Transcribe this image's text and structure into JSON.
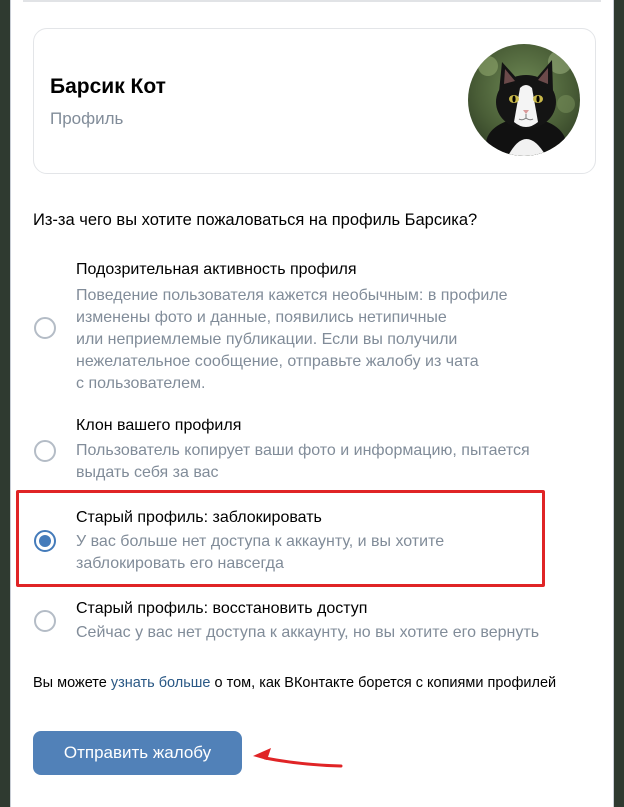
{
  "profile": {
    "name": "Барсик Кот",
    "subtitle": "Профиль",
    "avatar_icon": "cat-photo-avatar"
  },
  "question": "Из-за чего вы хотите пожаловаться на профиль Барсика?",
  "options": [
    {
      "title": "Подозрительная активность профиля",
      "description": "Поведение пользователя кажется необычным: в профиле\nизменены фото и данные, появились нетипичные\nили неприемлемые публикации. Если вы получили\nнежелательное сообщение, отправьте жалобу из чата\nс пользователем.",
      "selected": false
    },
    {
      "title": "Клон вашего профиля",
      "description": "Пользователь копирует ваши фото и информацию, пытается\nвыдать себя за вас",
      "selected": false
    },
    {
      "title": "Старый профиль: заблокировать",
      "description": "У вас больше нет доступа к аккаунту, и вы хотите\nзаблокировать его навсегда",
      "selected": true
    },
    {
      "title": "Старый профиль: восстановить доступ",
      "description": "Сейчас у вас нет доступа к аккаунту, но вы хотите его вернуть",
      "selected": false
    }
  ],
  "footnote": {
    "prefix": "Вы можете ",
    "link": "узнать больше",
    "suffix": " о том, как ВКонтакте борется с копиями профилей"
  },
  "submit_label": "Отправить жалобу",
  "colors": {
    "accent": "#5181b8",
    "highlight": "#e02426",
    "secondary_text": "#818c99"
  }
}
